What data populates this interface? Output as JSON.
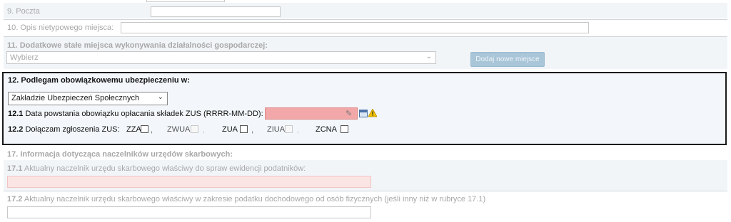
{
  "field9": {
    "label": "9. Poczta",
    "value": ""
  },
  "field10": {
    "label": "10. Opis nietypowego miejsca:",
    "value": ""
  },
  "field11": {
    "label": "11. Dodatkowe stałe miejsca wykonywania działalności gospodarczej:",
    "select_value": "Wybierz",
    "add_button": "Dodaj nowe miejsce"
  },
  "section12": {
    "title": "12. Podlegam obowiązkowemu ubezpieczeniu w:",
    "select_value": "Zakładzie Ubezpieczeń Społecznych",
    "date_num": "12.1",
    "date_label": "Data powstania obowiązku opłacania składek ZUS (RRRR-MM-DD):",
    "date_value": "",
    "zus_num": "12.2",
    "zus_label": "Dołączam zgłoszenia ZUS:",
    "options": [
      {
        "label": "ZZA",
        "checked": false,
        "enabled": true
      },
      {
        "label": "ZWUA",
        "checked": false,
        "enabled": false
      },
      {
        "label": "ZUA",
        "checked": false,
        "enabled": true
      },
      {
        "label": "ZIUA",
        "checked": false,
        "enabled": false
      },
      {
        "label": "ZCNA",
        "checked": false,
        "enabled": true
      }
    ],
    "dot": ","
  },
  "section17": {
    "title": "17. Informacja dotycząca naczelników urzędów skarbowych:",
    "f1_num": "17.1",
    "f1_label": "Aktualny naczelnik urzędu skarbowego właściwy do spraw ewidencji podatników:",
    "f1_value": "",
    "f2_num": "17.2",
    "f2_label": "Aktualny naczelnik urzędu skarbowego właściwy w zakresie podatku dochodowego od osób fizycznych (jeśli inny niż w rubryce 17.1)",
    "f2_value": ""
  },
  "colors": {
    "required_field": "#f2a8a8",
    "required_field_light": "#fbe4e4",
    "disabled_button": "#a9c5d8",
    "warning": "#f2c200"
  }
}
